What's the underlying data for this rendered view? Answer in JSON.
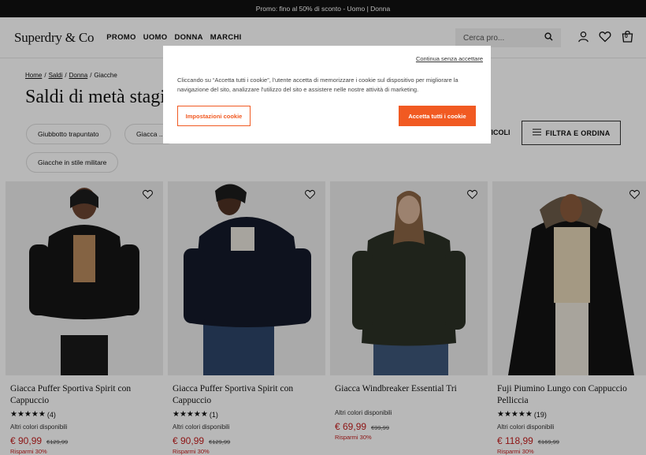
{
  "promo": {
    "text": "Promo: fino al 50% di sconto - Uomo | Donna"
  },
  "header": {
    "logo": "Superdry & Co",
    "nav": [
      "PROMO",
      "UOMO",
      "DONNA",
      "MARCHI"
    ],
    "search_placeholder": "Cerca pro...",
    "bag_count": "0",
    "icons": [
      "search-icon",
      "account-icon",
      "wishlist-icon",
      "bag-icon"
    ]
  },
  "breadcrumb": [
    "Home",
    "Saldi",
    "Donna",
    "Giacche"
  ],
  "page_title": "Saldi di metà stagione",
  "chips": [
    "Giubbotto trapuntato",
    "Giacca ...",
    "Giacche in stile militare"
  ],
  "articles_label": "TICOLI",
  "filter_label": "FILTRA E ORDINA",
  "products": [
    {
      "title": "Giacca Puffer Sportiva Spirit con Cappuccio",
      "stars": "★★★★★",
      "reviews": "(4)",
      "colors": "Altri colori disponibili",
      "price": "€ 90,99",
      "old_price": "€129,99",
      "save": "Risparmi 30%",
      "coat_color": "#161616",
      "skin": "#6b4431"
    },
    {
      "title": "Giacca Puffer Sportiva Spirit con Cappuccio",
      "stars": "★★★★★",
      "reviews": "(1)",
      "colors": "Altri colori disponibili",
      "price": "€ 90,99",
      "old_price": "€129,99",
      "save": "Risparmi 30%",
      "coat_color": "#141a2a",
      "skin": "#4e3123"
    },
    {
      "title": "Giacca Windbreaker Essential Tri",
      "stars": "",
      "reviews": "",
      "colors": "Altri colori disponibili",
      "price": "€ 69,99",
      "old_price": "€99,99",
      "save": "Risparmi 30%",
      "coat_color": "#2c3126",
      "skin": "#d9b49a"
    },
    {
      "title": "Fuji Piumino Lungo con Cappuccio Pelliccia",
      "stars": "★★★★★",
      "reviews": "(19)",
      "colors": "Altri colori disponibili",
      "price": "€ 118,99",
      "old_price": "€169,99",
      "save": "Risparmi 30%",
      "coat_color": "#121212",
      "skin": "#8a5a3c"
    }
  ],
  "cookie": {
    "continue": "Continua senza accettare",
    "text": "Cliccando su “Accetta tutti i cookie”, l'utente accetta di memorizzare i cookie sul dispositivo per migliorare la navigazione del sito, analizzare l'utilizzo del sito e assistere nelle nostre attività di marketing.",
    "settings": "Impostazioni cookie",
    "accept": "Accetta tutti i cookie"
  },
  "colors": {
    "accent": "#f15a22",
    "sale": "#c41e1e"
  }
}
